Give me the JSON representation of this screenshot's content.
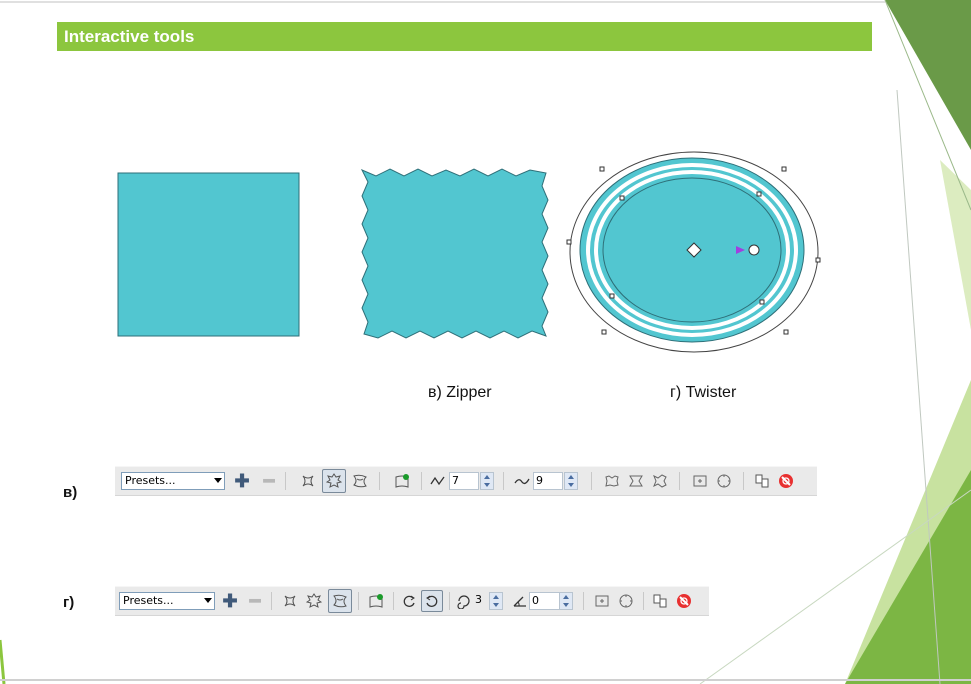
{
  "header": {
    "title": "Interactive tools"
  },
  "colors": {
    "accent_green": "#8cc63e",
    "shape_fill": "#52c6d0",
    "shape_stroke": "#2e6f78"
  },
  "captions": {
    "zipper": "в) Zipper",
    "twister": "г) Twister"
  },
  "toolbars": {
    "zipper": {
      "row_label": "в)",
      "presets_value": "Presets...",
      "amplitude_value": "7",
      "frequency_value": "9",
      "icons": [
        "add-preset-icon",
        "remove-preset-icon",
        "push-pull-distortion-icon",
        "zipper-distortion-icon",
        "twister-distortion-icon",
        "center-distortion-icon",
        "amplitude-icon",
        "frequency-icon",
        "random-distortion-icon",
        "smooth-distortion-icon",
        "local-distortion-icon",
        "copy-distortion-icon",
        "clear-distortion-icon",
        "copy-properties-icon",
        "clear-effect-icon"
      ]
    },
    "twister": {
      "row_label": "г)",
      "presets_value": "Presets...",
      "rotations_value": "3",
      "angle_value": "0",
      "icons": [
        "add-preset-icon",
        "remove-preset-icon",
        "push-pull-distortion-icon",
        "zipper-distortion-icon",
        "twister-distortion-icon",
        "center-distortion-icon",
        "clockwise-rotation-icon",
        "counterclockwise-rotation-icon",
        "rotations-icon",
        "angle-icon",
        "copy-distortion-icon",
        "clear-distortion-icon",
        "copy-properties-icon",
        "clear-effect-icon"
      ]
    }
  }
}
